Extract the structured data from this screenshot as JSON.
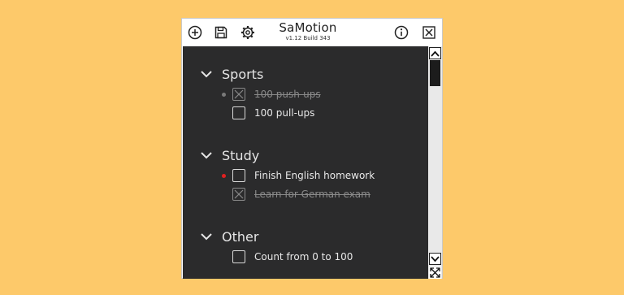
{
  "app": {
    "title": "SaMotion",
    "version": "v1.12 Build 343"
  },
  "toolbar": {
    "icons": [
      "add-icon",
      "save-icon",
      "settings-icon",
      "info-icon",
      "close-icon"
    ]
  },
  "colors": {
    "background": "#fdc96a",
    "panel": "#2b2b2c",
    "priority_low": "#7a7a7a",
    "priority_high": "#e02020"
  },
  "sections": [
    {
      "title": "Sports",
      "tasks": [
        {
          "label": "100 push-ups",
          "checked": true,
          "priority": "low"
        },
        {
          "label": "100 pull-ups",
          "checked": false,
          "priority": "none"
        }
      ]
    },
    {
      "title": "Study",
      "tasks": [
        {
          "label": "Finish English homework",
          "checked": false,
          "priority": "high"
        },
        {
          "label": "Learn for German exam",
          "checked": true,
          "priority": "none"
        }
      ]
    },
    {
      "title": "Other",
      "tasks": [
        {
          "label": "Count from 0 to 100",
          "checked": false,
          "priority": "none"
        }
      ]
    }
  ]
}
